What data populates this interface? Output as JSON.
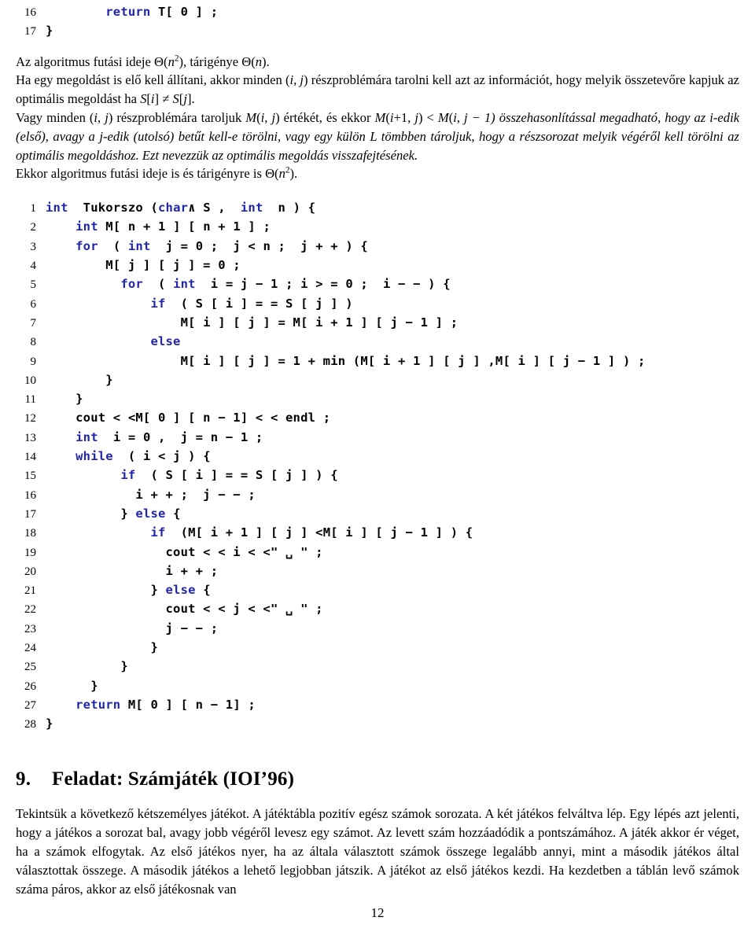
{
  "document": {
    "language": "hu",
    "page_number": "12"
  },
  "top_listing": {
    "name": "code-listing-top",
    "lines": [
      {
        "number": "16",
        "indent": 4,
        "tokens": [
          {
            "t": "return",
            "kw": true
          },
          {
            "t": " T[ 0 ] ;",
            "kw": false
          }
        ]
      },
      {
        "number": "17",
        "indent": 0,
        "tokens": [
          {
            "t": "}",
            "kw": false
          }
        ]
      }
    ]
  },
  "prose_blocks": [
    {
      "id": "para-complexity",
      "lines": [
        "Az algoritmus futási ideje Θ(n2), tárigénye Θ(n)."
      ],
      "html": "Az algoritmus futási ideje <span class=\"up\">Θ</span>(<i>n</i><sup>2</sup>), tárigénye <span class=\"up\">Θ</span>(<i>n</i>)."
    },
    {
      "id": "para-solution-construction",
      "html": "Ha egy megoldást is elő kell állítani, akkor minden (<i>i</i>, <i>j</i>) részproblémára tarolni kell azt az információt, hogy melyik összetevőre kapjuk az optimális megoldást ha <i>S</i>[<i>i</i>] ≠ <i>S</i>[<i>j</i>]."
    },
    {
      "id": "para-backtrack",
      "html": "Vagy minden (<i>i</i>, <i>j</i>) részproblémára taroljuk <i>M</i>(<i>i</i>, <i>j</i>) értékét, és ekkor <i>M</i>(<i>i</i>+1, <i>j</i>) &lt; <i>M</i>(<i>i</i>, <i>j</u> − 1) összehasonlítással megadható, hogy az <i>i</i>-edik (első), avagy a <i>j</i>-edik (utolsó) betűt kell-e törölni, vagy egy külön <i>L</i> tömbben tároljuk, hogy a részsorozat melyik végéről kell törölni az optimális megoldáshoz. Ezt nevezzük az optimális megoldás visszafejtésének."
    },
    {
      "id": "para-complexity-2",
      "html": "Ekkor algoritmus futási ideje is és tárigényre is <span class=\"up\">Θ</span>(<i>n</i><sup>2</sup>)."
    }
  ],
  "main_listing": {
    "name": "code-listing-tukorszo",
    "lines": [
      {
        "number": "1",
        "indent": 0,
        "tokens": [
          {
            "t": "int",
            "kw": true
          },
          {
            "t": "  Tukorszo (",
            "kw": false
          },
          {
            "t": "char",
            "kw": true
          },
          {
            "t": "∧ S ,  ",
            "kw": false
          },
          {
            "t": "int",
            "kw": true
          },
          {
            "t": "  n ) {",
            "kw": false
          }
        ]
      },
      {
        "number": "2",
        "indent": 2,
        "tokens": [
          {
            "t": "int",
            "kw": true
          },
          {
            "t": " M[ n + 1 ] [ n + 1 ] ;",
            "kw": false
          }
        ]
      },
      {
        "number": "3",
        "indent": 2,
        "tokens": [
          {
            "t": "for",
            "kw": true
          },
          {
            "t": "  ( ",
            "kw": false
          },
          {
            "t": "int",
            "kw": true
          },
          {
            "t": "  j = 0 ;  j < n ;  j + + ) {",
            "kw": false
          }
        ]
      },
      {
        "number": "4",
        "indent": 4,
        "tokens": [
          {
            "t": "M[ j ] [ j ] = 0 ;",
            "kw": false
          }
        ]
      },
      {
        "number": "5",
        "indent": 5,
        "tokens": [
          {
            "t": "for",
            "kw": true
          },
          {
            "t": "  ( ",
            "kw": false
          },
          {
            "t": "int",
            "kw": true
          },
          {
            "t": "  i = j − 1 ; i > = 0 ;  i − − ) {",
            "kw": false
          }
        ]
      },
      {
        "number": "6",
        "indent": 7,
        "tokens": [
          {
            "t": "if",
            "kw": true
          },
          {
            "t": "  ( S [ i ] = = S [ j ] )",
            "kw": false
          }
        ]
      },
      {
        "number": "7",
        "indent": 9,
        "tokens": [
          {
            "t": "M[ i ] [ j ] = M[ i + 1 ] [ j − 1 ] ;",
            "kw": false
          }
        ]
      },
      {
        "number": "8",
        "indent": 7,
        "tokens": [
          {
            "t": "else",
            "kw": true
          }
        ]
      },
      {
        "number": "9",
        "indent": 9,
        "tokens": [
          {
            "t": "M[ i ] [ j ] = 1 + min (M[ i + 1 ] [ j ] ,M[ i ] [ j − 1 ] ) ;",
            "kw": false
          }
        ]
      },
      {
        "number": "10",
        "indent": 4,
        "tokens": [
          {
            "t": "}",
            "kw": false
          }
        ]
      },
      {
        "number": "11",
        "indent": 2,
        "tokens": [
          {
            "t": "}",
            "kw": false
          }
        ]
      },
      {
        "number": "12",
        "indent": 2,
        "tokens": [
          {
            "t": "cout < <M[ 0 ] [ n − 1] < < endl ;",
            "kw": false
          }
        ]
      },
      {
        "number": "13",
        "indent": 2,
        "tokens": [
          {
            "t": "int",
            "kw": true
          },
          {
            "t": "  i = 0 ,  j = n − 1 ;",
            "kw": false
          }
        ]
      },
      {
        "number": "14",
        "indent": 2,
        "tokens": [
          {
            "t": "while",
            "kw": true
          },
          {
            "t": "  ( i < j ) {",
            "kw": false
          }
        ]
      },
      {
        "number": "15",
        "indent": 5,
        "tokens": [
          {
            "t": "if",
            "kw": true
          },
          {
            "t": "  ( S [ i ] = = S [ j ] ) {",
            "kw": false
          }
        ]
      },
      {
        "number": "16",
        "indent": 6,
        "tokens": [
          {
            "t": "i + + ;  j − − ;",
            "kw": false
          }
        ]
      },
      {
        "number": "17",
        "indent": 5,
        "tokens": [
          {
            "t": "} ",
            "kw": false
          },
          {
            "t": "else",
            "kw": true
          },
          {
            "t": " {",
            "kw": false
          }
        ]
      },
      {
        "number": "18",
        "indent": 7,
        "tokens": [
          {
            "t": "if",
            "kw": true
          },
          {
            "t": "  (M[ i + 1 ] [ j ] <M[ i ] [ j − 1 ] ) {",
            "kw": false
          }
        ]
      },
      {
        "number": "19",
        "indent": 8,
        "tokens": [
          {
            "t": "cout < < i < <\" ␣ \" ;",
            "kw": false
          }
        ]
      },
      {
        "number": "20",
        "indent": 8,
        "tokens": [
          {
            "t": "i + + ;",
            "kw": false
          }
        ]
      },
      {
        "number": "21",
        "indent": 7,
        "tokens": [
          {
            "t": "} ",
            "kw": false
          },
          {
            "t": "else",
            "kw": true
          },
          {
            "t": " {",
            "kw": false
          }
        ]
      },
      {
        "number": "22",
        "indent": 8,
        "tokens": [
          {
            "t": "cout < < j < <\" ␣ \" ;",
            "kw": false
          }
        ]
      },
      {
        "number": "23",
        "indent": 8,
        "tokens": [
          {
            "t": "j − − ;",
            "kw": false
          }
        ]
      },
      {
        "number": "24",
        "indent": 7,
        "tokens": [
          {
            "t": "}",
            "kw": false
          }
        ]
      },
      {
        "number": "25",
        "indent": 5,
        "tokens": [
          {
            "t": "}",
            "kw": false
          }
        ]
      },
      {
        "number": "26",
        "indent": 3,
        "tokens": [
          {
            "t": "}",
            "kw": false
          }
        ]
      },
      {
        "number": "27",
        "indent": 2,
        "tokens": [
          {
            "t": "return",
            "kw": true
          },
          {
            "t": " M[ 0 ] [ n − 1] ;",
            "kw": false
          }
        ]
      },
      {
        "number": "28",
        "indent": 0,
        "tokens": [
          {
            "t": "}",
            "kw": false
          }
        ]
      }
    ]
  },
  "section": {
    "number": "9.",
    "title": "Feladat: Számjáték (IOI’96)"
  },
  "section_body": {
    "id": "para-numbers-game",
    "html": "Tekintsük a következő kétszemélyes játékot. A játéktábla pozitív egész számok sorozata. A két játékos felváltva lép. Egy lépés azt jelenti, hogy a játékos a sorozat bal, avagy jobb végéről levesz egy számot. Az levett szám hozzáadódik a pontszámához. A játék akkor ér véget, ha a számok elfogytak. Az első játékos nyer, ha az általa választott számok összege legalább annyi, mint a második játékos által választottak összege. A második játékos a lehető legjobban játszik. A játékot az első játékos kezdi. Ha kezdetben a táblán levő számok száma páros, akkor az első játékosnak van"
  },
  "colors": {
    "keyword_blue": "#2226a8",
    "text_black": "#000000",
    "page_background": "#ffffff"
  }
}
